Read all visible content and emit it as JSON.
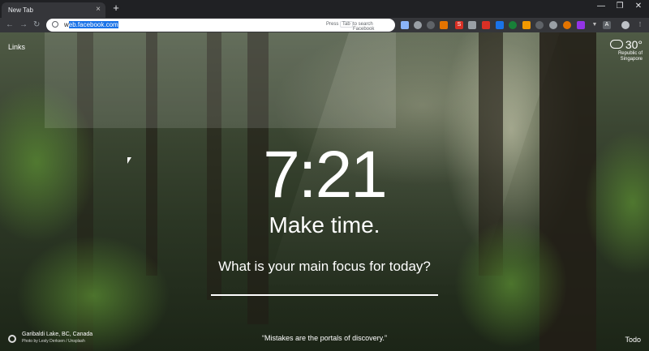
{
  "browser": {
    "tab_title": "New Tab",
    "tab_close": "×",
    "new_tab": "+",
    "window_controls": [
      "—",
      "❐",
      "✕"
    ],
    "address_prefix": "w",
    "address_selected": "eb.facebook.com",
    "hint_press": "Press",
    "hint_key": "Tab",
    "hint_action": "to search Facebook"
  },
  "page": {
    "links_label": "Links",
    "weather_temp": "30°",
    "weather_location_line1": "Republic of",
    "weather_location_line2": "Singapore",
    "time": "7:21",
    "greeting": "Make time.",
    "focus_question": "What is your main focus for today?",
    "photo_location": "Garibaldi Lake, BC, Canada",
    "photo_credit": "Photo by Lesly Derksen / Unsplash",
    "quote": "“Mistakes are the portals of discovery.”",
    "todo_label": "Todo"
  },
  "colors": {
    "accent": "#1a73e8",
    "chrome_dark": "#202124",
    "toolbar": "#35363a"
  }
}
